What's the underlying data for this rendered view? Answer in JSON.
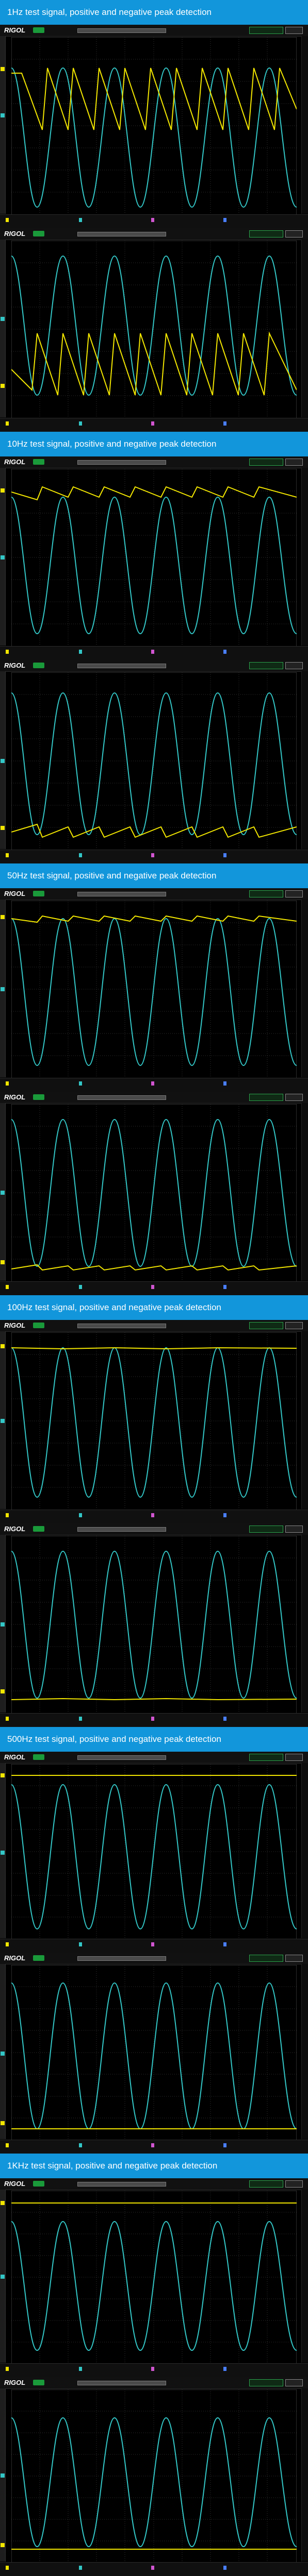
{
  "sections": [
    {
      "heading": "1Hz test signal, positive and negative peak detection"
    },
    {
      "heading": "10Hz test signal, positive and negative peak detection"
    },
    {
      "heading": "50Hz test signal, positive and negative peak detection"
    },
    {
      "heading": "100Hz test signal, positive and negative peak detection"
    },
    {
      "heading": "500Hz test signal, positive and negative peak detection"
    },
    {
      "heading": "1KHz test signal, positive and negative peak detection"
    }
  ],
  "scope": {
    "brand": "RIGOL",
    "colors": {
      "banner": "#1296db",
      "ch1_trace": "#f2e600",
      "ch2_trace": "#33c7c7",
      "grid": "#3a3a3a"
    }
  },
  "icons": {
    "trigger": "trigger-icon",
    "run_state": "run-indicator-icon"
  }
}
